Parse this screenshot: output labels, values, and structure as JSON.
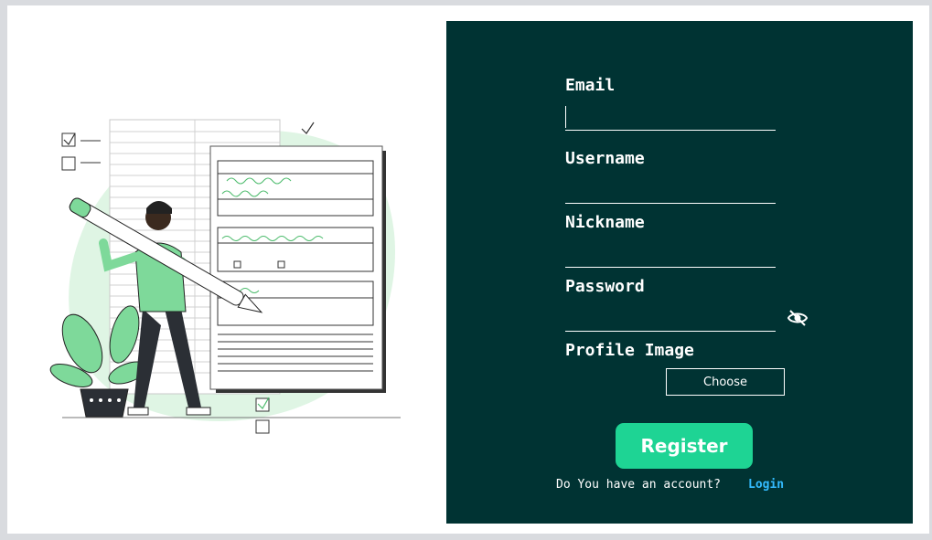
{
  "form": {
    "email_label": "Email",
    "email_value": "",
    "username_label": "Username",
    "username_value": "",
    "nickname_label": "Nickname",
    "nickname_value": "",
    "password_label": "Password",
    "password_value": "",
    "password_toggle_icon": "eye-slash-icon",
    "profile_image_label": "Profile Image",
    "choose_label": "Choose",
    "register_label": "Register",
    "account_prompt": "Do You have an account?",
    "login_link": "Login"
  },
  "colors": {
    "panel_bg": "#003333",
    "accent_green": "#1ed494",
    "link_blue": "#33bbff",
    "illustration_green": "#7ed99a"
  }
}
